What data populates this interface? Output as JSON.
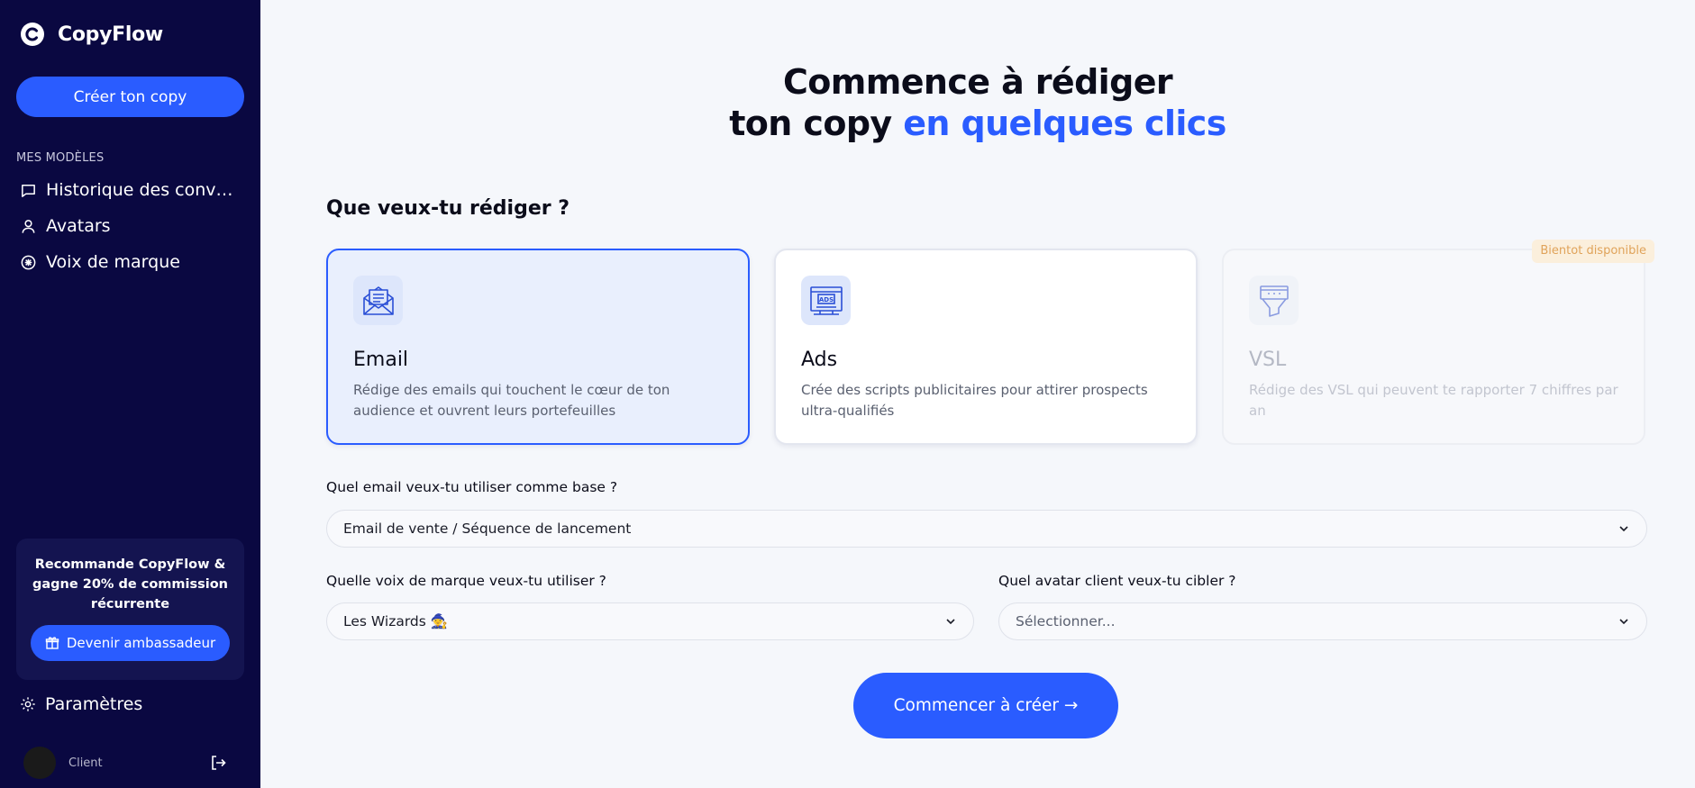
{
  "app": {
    "name": "CopyFlow"
  },
  "sidebar": {
    "create_label": "Créer ton copy",
    "section_label": "MES MODÈLES",
    "items": [
      {
        "label": "Historique des conversations",
        "icon": "chat-icon"
      },
      {
        "label": "Avatars",
        "icon": "user-icon"
      },
      {
        "label": "Voix de marque",
        "icon": "brand-voice-icon"
      }
    ],
    "promo": {
      "text": "Recommande CopyFlow & gagne 20% de commission récurrente",
      "button_label": "Devenir ambassadeur"
    },
    "settings_label": "Paramètres",
    "user_name": "Client"
  },
  "main": {
    "hero_line1": "Commence à rédiger",
    "hero_line2_plain": "ton copy ",
    "hero_line2_accent": "en quelques clics",
    "question": "Que veux-tu rédiger ?",
    "cards": [
      {
        "title": "Email",
        "description": "Rédige des emails qui touchent le cœur de ton audience et ouvrent leurs portefeuilles",
        "icon": "email-icon",
        "state": "selected"
      },
      {
        "title": "Ads",
        "description": "Crée des scripts publicitaires pour attirer prospects ultra-qualifiés",
        "icon": "ads-icon",
        "icon_text": "ADS",
        "state": "default"
      },
      {
        "title": "VSL",
        "description": "Rédige des VSL qui peuvent te rapporter 7 chiffres par an",
        "icon": "funnel-icon",
        "state": "disabled",
        "badge": "Bientot disponible"
      }
    ],
    "email_base": {
      "label": "Quel email veux-tu utiliser comme base ?",
      "value": "Email de vente / Séquence de lancement"
    },
    "brand_voice": {
      "label": "Quelle voix de marque veux-tu utiliser ?",
      "value": "Les Wizards 🧙"
    },
    "avatar": {
      "label": "Quel avatar client veux-tu cibler ?",
      "value": "Sélectionner..."
    },
    "start_label": "Commencer à créer →"
  },
  "colors": {
    "sidebar_bg": "#0a0841",
    "accent": "#2a5cff",
    "badge_bg": "#fbefdc",
    "badge_text": "#e0a35a"
  }
}
